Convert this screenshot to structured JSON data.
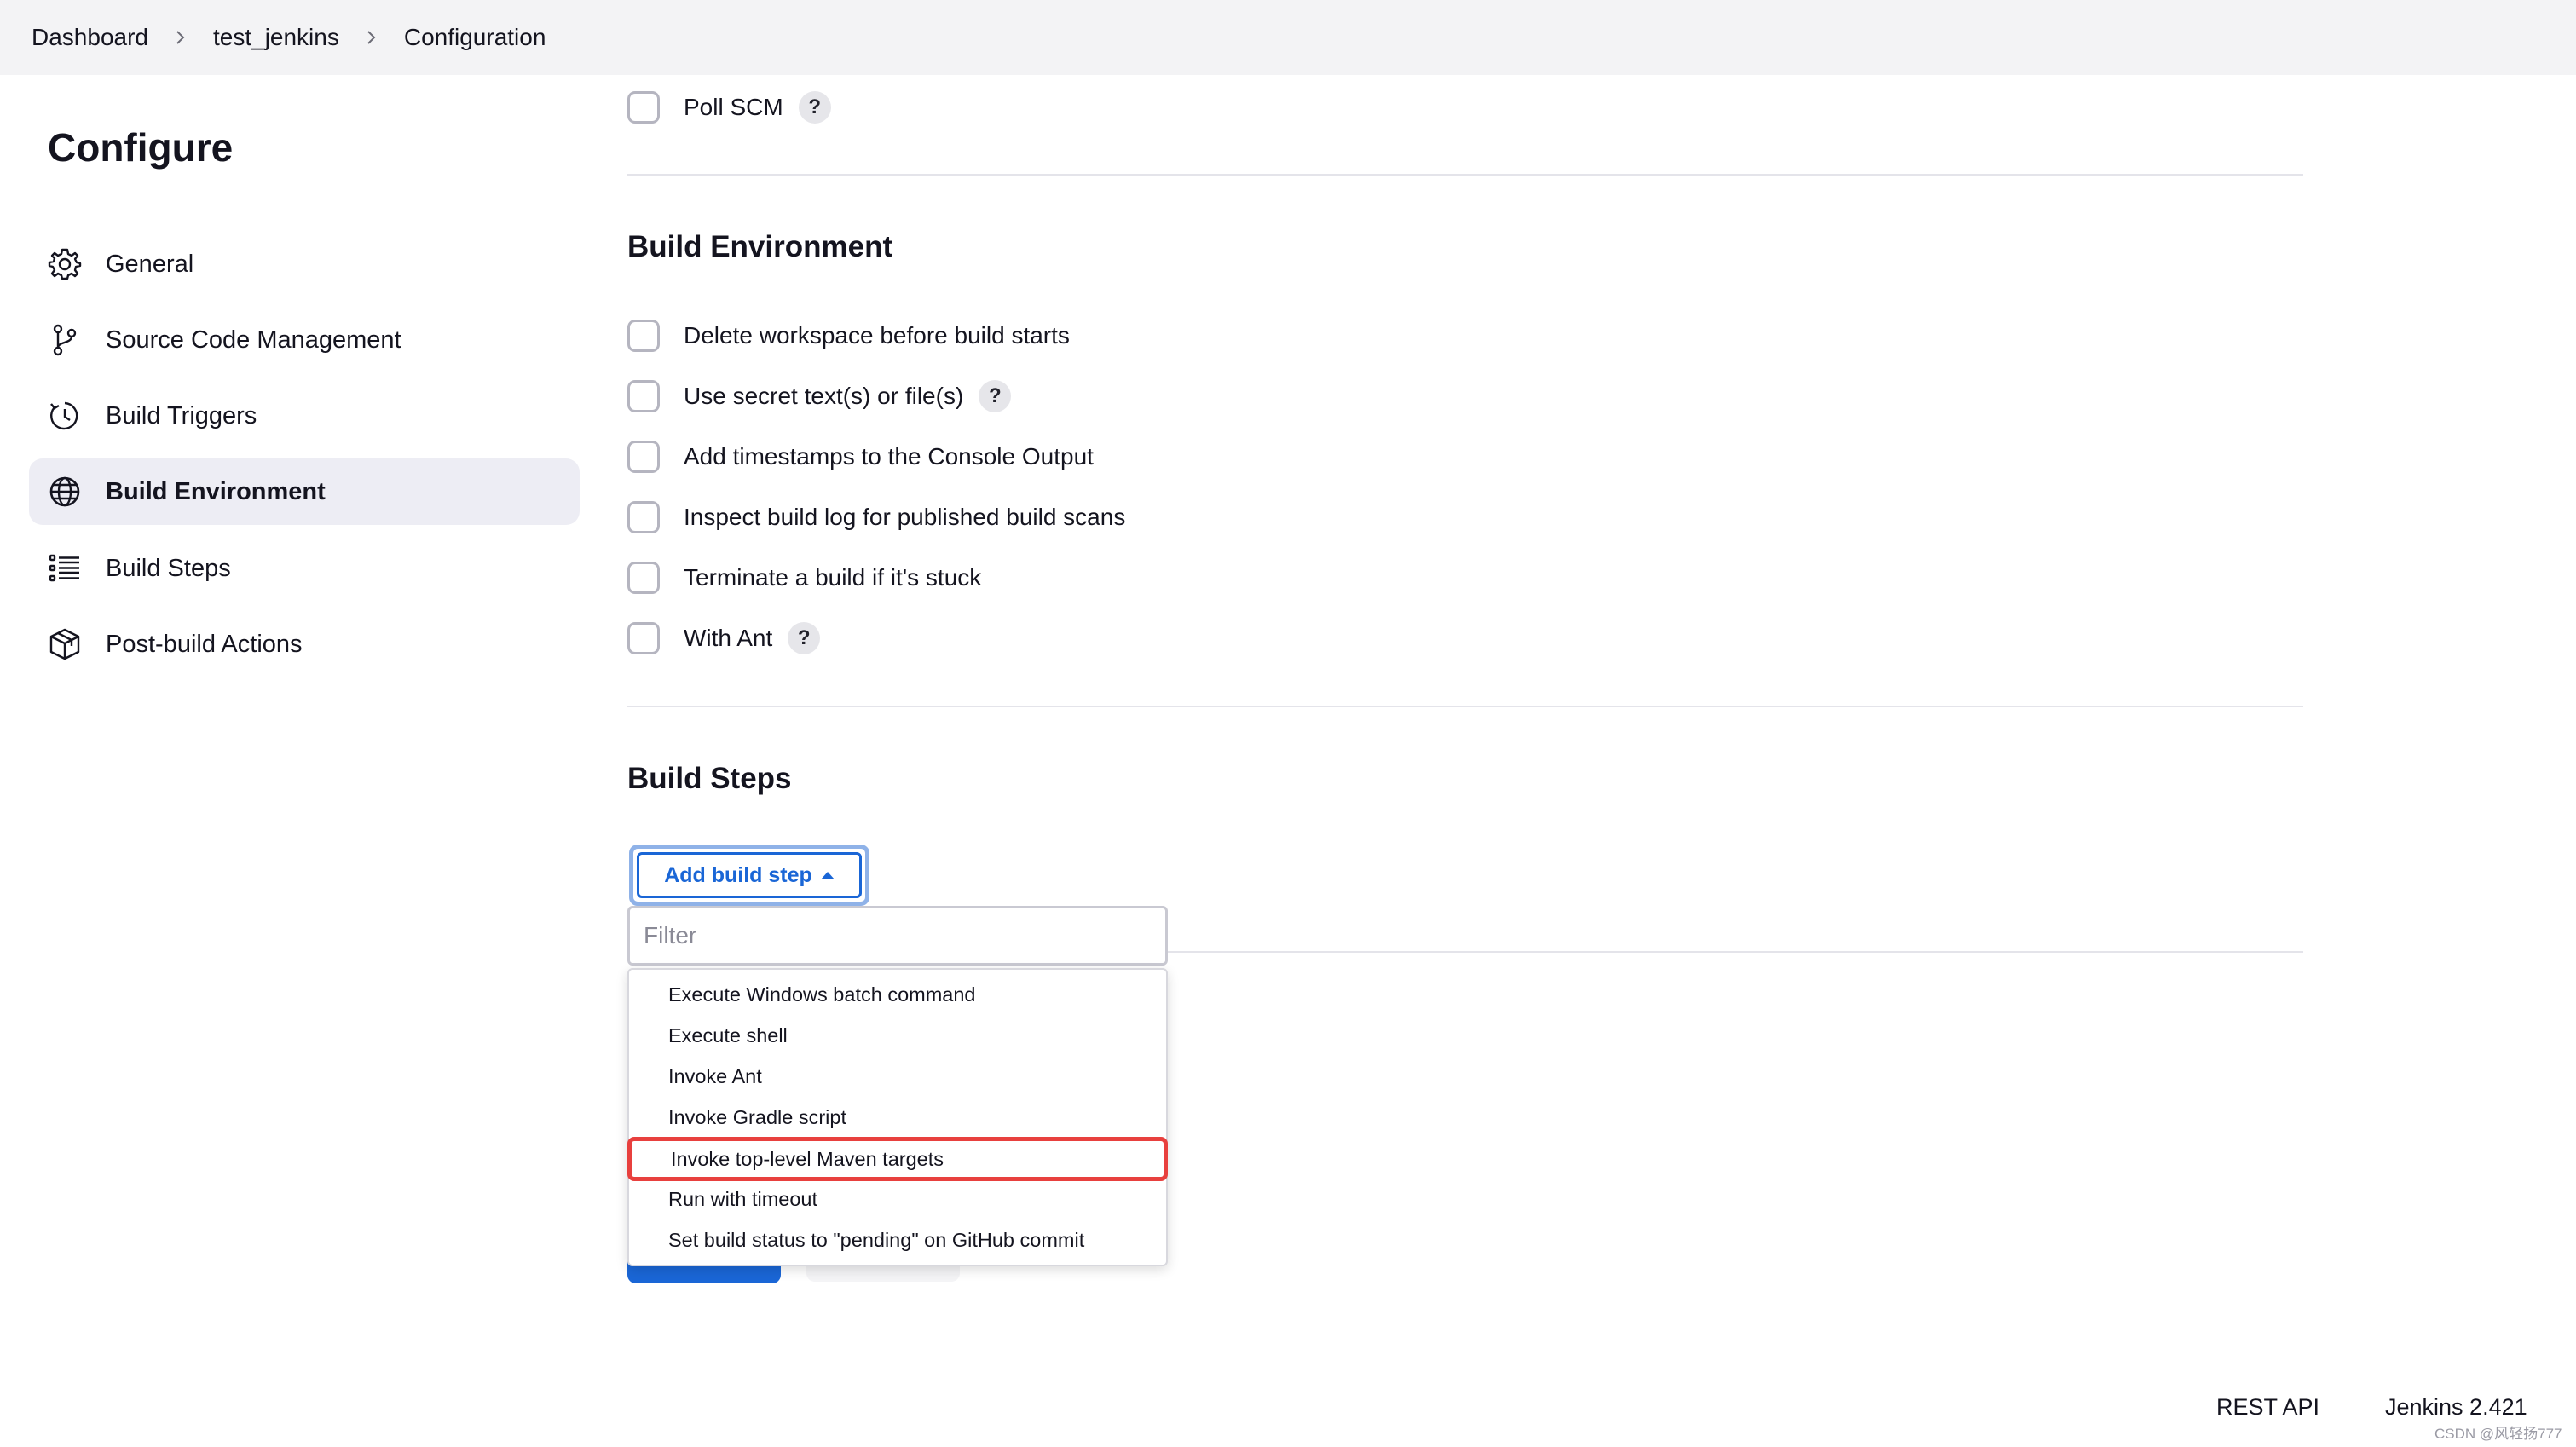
{
  "breadcrumb": {
    "items": [
      "Dashboard",
      "test_jenkins",
      "Configuration"
    ]
  },
  "sidebar": {
    "title": "Configure",
    "items": [
      {
        "label": "General",
        "icon": "gear-icon"
      },
      {
        "label": "Source Code Management",
        "icon": "branch-icon"
      },
      {
        "label": "Build Triggers",
        "icon": "clock-icon"
      },
      {
        "label": "Build Environment",
        "icon": "globe-icon",
        "active": true
      },
      {
        "label": "Build Steps",
        "icon": "list-icon"
      },
      {
        "label": "Post-build Actions",
        "icon": "package-icon"
      }
    ]
  },
  "triggers": {
    "poll_scm_label": "Poll SCM"
  },
  "build_environment": {
    "title": "Build Environment",
    "options": [
      {
        "label": "Delete workspace before build starts",
        "help": false
      },
      {
        "label": "Use secret text(s) or file(s)",
        "help": true
      },
      {
        "label": "Add timestamps to the Console Output",
        "help": false
      },
      {
        "label": "Inspect build log for published build scans",
        "help": false
      },
      {
        "label": "Terminate a build if it's stuck",
        "help": false
      },
      {
        "label": "With Ant",
        "help": true
      }
    ]
  },
  "build_steps": {
    "title": "Build Steps",
    "add_button_label": "Add build step",
    "filter_placeholder": "Filter",
    "menu_items": [
      "Execute Windows batch command",
      "Execute shell",
      "Invoke Ant",
      "Invoke Gradle script",
      "Invoke top-level Maven targets",
      "Run with timeout",
      "Set build status to \"pending\" on GitHub commit"
    ],
    "highlighted_item": "Invoke top-level Maven targets"
  },
  "help_symbol": "?",
  "footer": {
    "rest_api": "REST API",
    "version": "Jenkins 2.421",
    "watermark": "CSDN @风轻扬777"
  },
  "colors": {
    "accent": "#1a66d6",
    "highlight_border": "#e8403e",
    "sidebar_active_bg": "#ededf4",
    "topbar_bg": "#f3f3f5"
  }
}
